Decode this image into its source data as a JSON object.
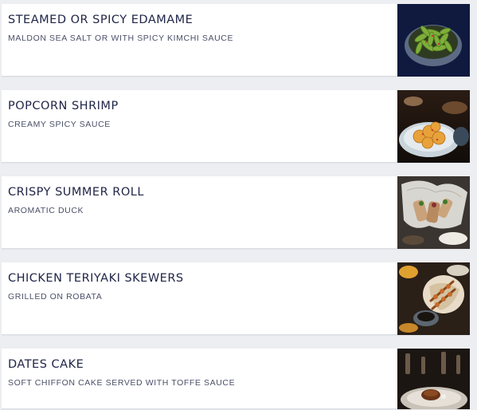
{
  "menu_items": [
    {
      "title": "STEAMED OR SPICY EDAMAME",
      "description": "MALDON SEA SALT OR WITH SPICY KIMCHI SAUCE",
      "image_icon": "edamame-bowl-photo"
    },
    {
      "title": "POPCORN SHRIMP",
      "description": "CREAMY SPICY SAUCE",
      "image_icon": "popcorn-shrimp-photo"
    },
    {
      "title": "CRISPY SUMMER ROLL",
      "description": "AROMATIC DUCK",
      "image_icon": "summer-roll-photo"
    },
    {
      "title": "CHICKEN TERIYAKI SKEWERS",
      "description": "GRILLED ON ROBATA",
      "image_icon": "teriyaki-skewers-photo"
    },
    {
      "title": "DATES CAKE",
      "description": "SOFT CHIFFON CAKE SERVED WITH TOFFE SAUCE",
      "image_icon": "dates-cake-photo"
    }
  ],
  "colors": {
    "title": "#1e2446",
    "description": "#4a5068",
    "background": "#eceef1",
    "card": "#ffffff"
  }
}
